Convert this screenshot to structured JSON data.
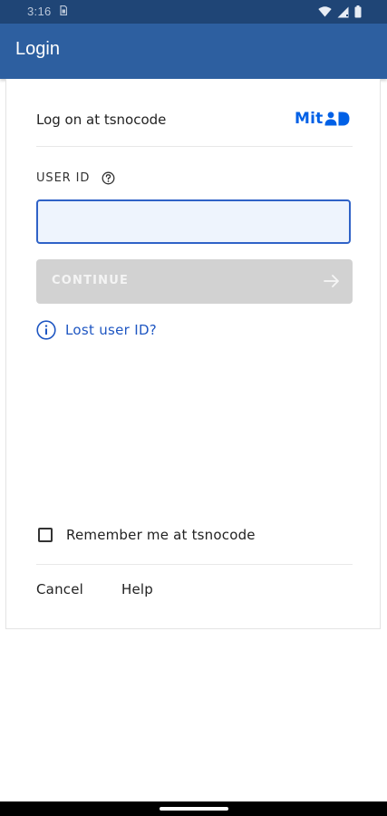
{
  "status_bar": {
    "time": "3:16",
    "icons": [
      "sim-card-icon",
      "wifi-icon",
      "signal-icon",
      "battery-icon"
    ]
  },
  "app_bar": {
    "title": "Login"
  },
  "login": {
    "title": "Log on at tsnocode",
    "logo_text": "Mit",
    "user_id_label": "USER ID",
    "user_id_value": "",
    "continue_label": "CONTINUE",
    "lost_user_id": "Lost user ID?",
    "remember_label": "Remember me at tsnocode",
    "remember_checked": false,
    "cancel_label": "Cancel",
    "help_label": "Help"
  },
  "colors": {
    "app_bar": "#2d5fa0",
    "status_bar": "#1f4576",
    "accent": "#2f62c7",
    "link": "#1e56c2",
    "logo": "#0060e6",
    "disabled_button": "#d2d2d2"
  }
}
